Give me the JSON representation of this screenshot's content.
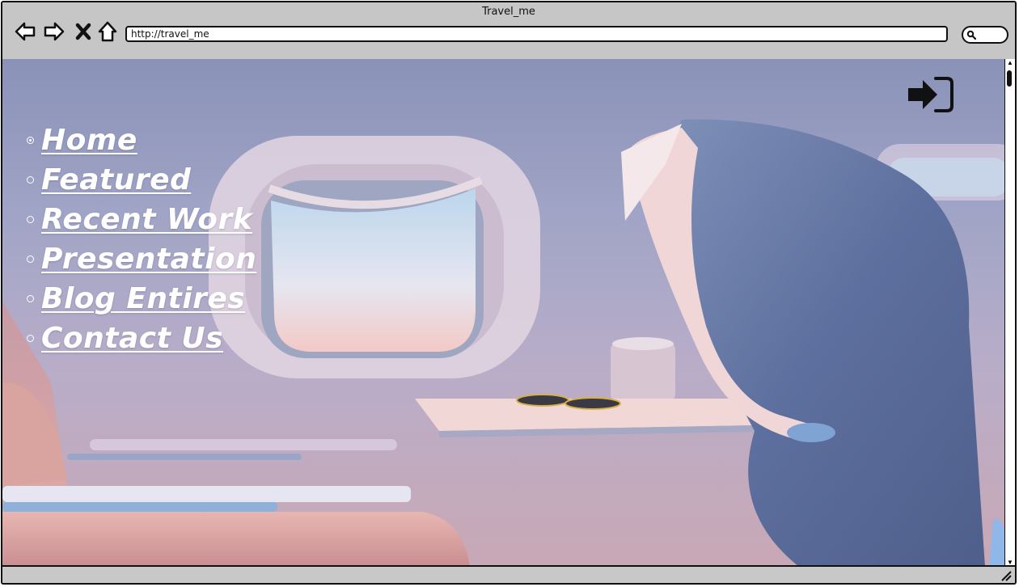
{
  "window": {
    "title": "Travel_me"
  },
  "browser": {
    "url": "http://travel_me"
  },
  "nav_menu": [
    {
      "label": "Home",
      "active": true
    },
    {
      "label": "Featured",
      "active": false
    },
    {
      "label": "Recent Work",
      "active": false
    },
    {
      "label": "Presentation",
      "active": false
    },
    {
      "label": "Blog Entires",
      "active": false
    },
    {
      "label": "Contact Us",
      "active": false
    }
  ],
  "icons": {
    "back": "arrow-left-icon",
    "forward": "arrow-right-icon",
    "stop": "close-icon",
    "home": "home-icon",
    "search": "search-icon",
    "login": "sign-in-icon"
  },
  "colors": {
    "menu_text": "#ffffff",
    "chrome": "#c6c6c6"
  }
}
